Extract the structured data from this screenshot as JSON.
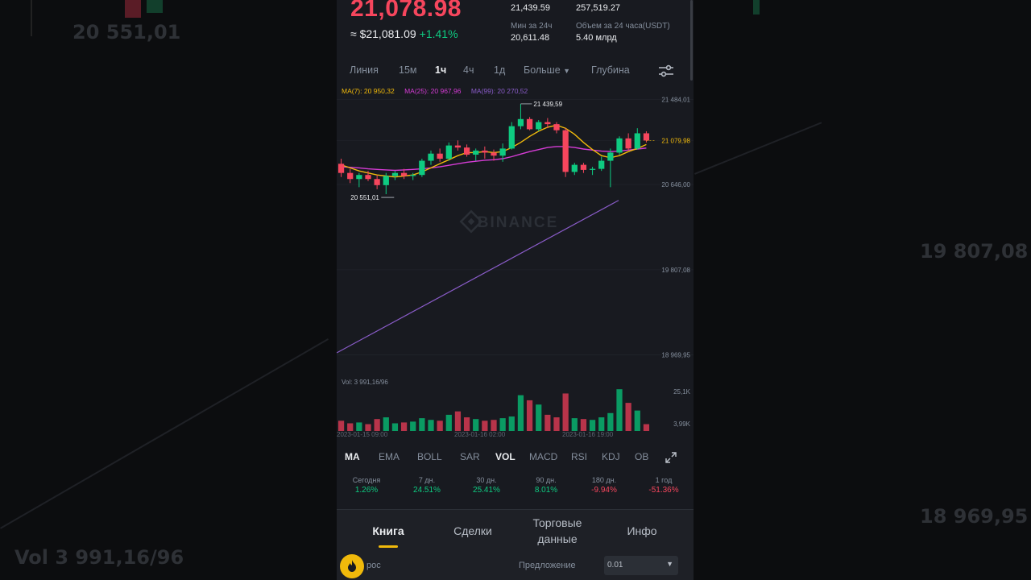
{
  "background": {
    "blur_price_top": "20 551,01",
    "blur_price_right_1": "19 807,08",
    "blur_price_right_2": "18 969,95",
    "blur_vol_label": "Vol 3 991,16/96"
  },
  "ticker": {
    "price": "21,078.98",
    "approx_usd": "≈ $21,081.09",
    "change_pct": "+1.41%",
    "high_24h_value": "21,439.59",
    "low_24h_label": "Мин за 24ч",
    "low_24h_value": "20,611.48",
    "vol_btc_value": "257,519.27",
    "vol_usdt_label": "Объем за 24 часа(USDT)",
    "vol_usdt_value": "5.40 млрд"
  },
  "timeframes": {
    "items": [
      "Линия",
      "15м",
      "1ч",
      "4ч",
      "1д",
      "Больше",
      "Глубина"
    ],
    "active": "1ч"
  },
  "ma_legend": {
    "ma7": "MA(7): 20 950,32",
    "ma25": "MA(25): 20 967,96",
    "ma99": "MA(99): 20 270,52"
  },
  "chart_data": {
    "type": "candlestick",
    "price_axis_labels": [
      "21 484,01",
      "21 078,98",
      "20 646,00",
      "19 807,08",
      "18 969,95"
    ],
    "volume_axis_labels": [
      "25,1K",
      "3,99K"
    ],
    "time_labels": [
      "2023-01-15 09:00",
      "2023-01-16 02:00",
      "2023-01-16 19:00"
    ],
    "last_price_label": "21 079,98",
    "high_marker": "21 439,59",
    "low_marker": "20 551,01",
    "watermark": "BINANCE",
    "volume_label": "Vol: 3 991,16/96",
    "price_min": 18800,
    "price_max": 21550,
    "candles": [
      [
        20850,
        20900,
        20720,
        20760
      ],
      [
        20760,
        20800,
        20660,
        20700
      ],
      [
        20700,
        20760,
        20620,
        20740
      ],
      [
        20740,
        20780,
        20680,
        20700
      ],
      [
        20700,
        20740,
        20600,
        20640
      ],
      [
        20640,
        20760,
        20551,
        20730
      ],
      [
        20730,
        20780,
        20690,
        20760
      ],
      [
        20760,
        20800,
        20700,
        20730
      ],
      [
        20730,
        20760,
        20690,
        20740
      ],
      [
        20740,
        20900,
        20720,
        20880
      ],
      [
        20880,
        20980,
        20840,
        20950
      ],
      [
        20950,
        21000,
        20870,
        20900
      ],
      [
        20900,
        21060,
        20880,
        21030
      ],
      [
        21030,
        21080,
        20980,
        21010
      ],
      [
        21010,
        21040,
        20920,
        20940
      ],
      [
        20940,
        21000,
        20880,
        20980
      ],
      [
        20980,
        21020,
        20900,
        20960
      ],
      [
        20960,
        20990,
        20880,
        20930
      ],
      [
        20930,
        21050,
        20870,
        21000
      ],
      [
        21000,
        21260,
        20990,
        21220
      ],
      [
        21220,
        21439.59,
        21190,
        21290
      ],
      [
        21290,
        21310,
        21180,
        21190
      ],
      [
        21190,
        21280,
        21170,
        21260
      ],
      [
        21260,
        21300,
        21200,
        21240
      ],
      [
        21240,
        21260,
        21150,
        21180
      ],
      [
        21180,
        21200,
        20720,
        20770
      ],
      [
        20770,
        20860,
        20740,
        20840
      ],
      [
        20840,
        20860,
        20760,
        20790
      ],
      [
        20790,
        20820,
        20740,
        20800
      ],
      [
        20800,
        20920,
        20780,
        20880
      ],
      [
        20880,
        21000,
        20620,
        20960
      ],
      [
        20960,
        21120,
        20940,
        21100
      ],
      [
        21100,
        21150,
        20980,
        21000
      ],
      [
        21000,
        21200,
        20990,
        21150
      ],
      [
        21150,
        21170,
        21060,
        21079
      ]
    ],
    "ma7": [
      20840,
      20810,
      20780,
      20760,
      20740,
      20730,
      20720,
      20730,
      20740,
      20770,
      20810,
      20850,
      20890,
      20930,
      20960,
      20960,
      20970,
      20960,
      20970,
      21010,
      21060,
      21120,
      21170,
      21210,
      21230,
      21200,
      21140,
      21060,
      20990,
      20930,
      20910,
      20930,
      20970,
      21000,
      21040
    ],
    "ma25": [
      20820,
      20815,
      20810,
      20800,
      20795,
      20790,
      20785,
      20790,
      20795,
      20800,
      20810,
      20820,
      20835,
      20850,
      20865,
      20875,
      20885,
      20890,
      20900,
      20920,
      20945,
      20970,
      20990,
      21010,
      21020,
      21020,
      21010,
      20995,
      20985,
      20975,
      20970,
      20975,
      20985,
      20995,
      21005
    ],
    "ma99_start": 18990,
    "ma99_end": 20490,
    "volume": [
      1.2,
      0.9,
      1.0,
      0.8,
      1.4,
      1.6,
      0.9,
      1.0,
      1.1,
      1.5,
      1.3,
      1.2,
      1.9,
      2.3,
      1.6,
      1.4,
      1.2,
      1.3,
      1.5,
      1.7,
      4.2,
      3.6,
      3.1,
      1.9,
      1.6,
      4.4,
      1.5,
      1.4,
      1.3,
      1.6,
      2.1,
      4.9,
      3.3,
      2.4,
      0.8
    ]
  },
  "indicators": {
    "items": [
      "MA",
      "EMA",
      "BOLL",
      "SAR",
      "VOL",
      "MACD",
      "RSI",
      "KDJ",
      "OB"
    ],
    "active": [
      "MA",
      "VOL"
    ]
  },
  "performance": [
    {
      "label": "Сегодня",
      "value": "1.26%"
    },
    {
      "label": "7 дн.",
      "value": "24.51%"
    },
    {
      "label": "30 дн.",
      "value": "25.41%"
    },
    {
      "label": "90 дн.",
      "value": "8.01%"
    },
    {
      "label": "180 дн.",
      "value": "-9.94%"
    },
    {
      "label": "1 год",
      "value": "-51.36%"
    }
  ],
  "tabs": [
    {
      "label": "Книга"
    },
    {
      "label": "Сделки"
    },
    {
      "label": "Торговые\nданные"
    },
    {
      "label": "Инфо"
    }
  ],
  "order_book": {
    "left_label": "рос",
    "offer_label": "Предложение",
    "precision": "0.01"
  },
  "colors": {
    "up": "#0ecb81",
    "down": "#f6465d",
    "accent": "#f0b90b",
    "ma7": "#f0b90b",
    "ma25": "#d63cd6",
    "ma99": "#8a5cc9"
  }
}
